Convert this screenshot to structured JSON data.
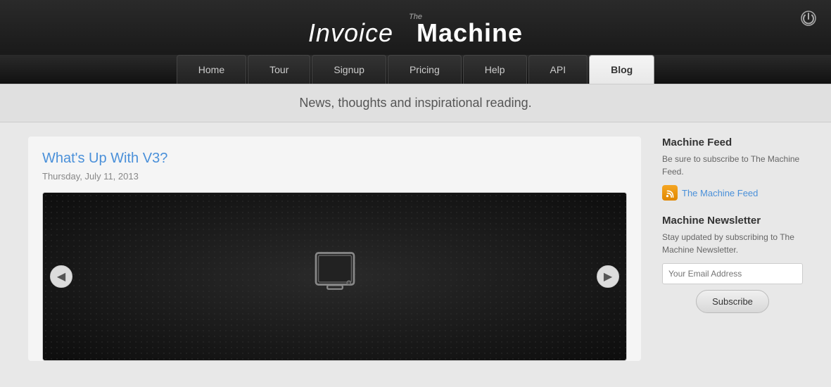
{
  "header": {
    "logo_the": "The",
    "logo_invoice": "Invoice",
    "logo_machine": "Machine",
    "power_icon": "⏻"
  },
  "nav": {
    "items": [
      {
        "label": "Home",
        "active": false
      },
      {
        "label": "Tour",
        "active": false
      },
      {
        "label": "Signup",
        "active": false
      },
      {
        "label": "Pricing",
        "active": false
      },
      {
        "label": "Help",
        "active": false
      },
      {
        "label": "API",
        "active": false
      },
      {
        "label": "Blog",
        "active": true
      }
    ]
  },
  "subtitle": "News, thoughts and inspirational reading.",
  "article": {
    "title": "What's Up With V3?",
    "date": "Thursday, July 11, 2013"
  },
  "slideshow": {
    "arrow_left": "◀",
    "arrow_right": "▶"
  },
  "sidebar": {
    "feed_heading": "Machine Feed",
    "feed_text": "Be sure to subscribe to The Machine Feed.",
    "feed_link_label": "The Machine Feed",
    "newsletter_heading": "Machine Newsletter",
    "newsletter_text": "Stay updated by subscribing to The Machine Newsletter.",
    "email_placeholder": "Your Email Address",
    "subscribe_label": "Subscribe"
  }
}
